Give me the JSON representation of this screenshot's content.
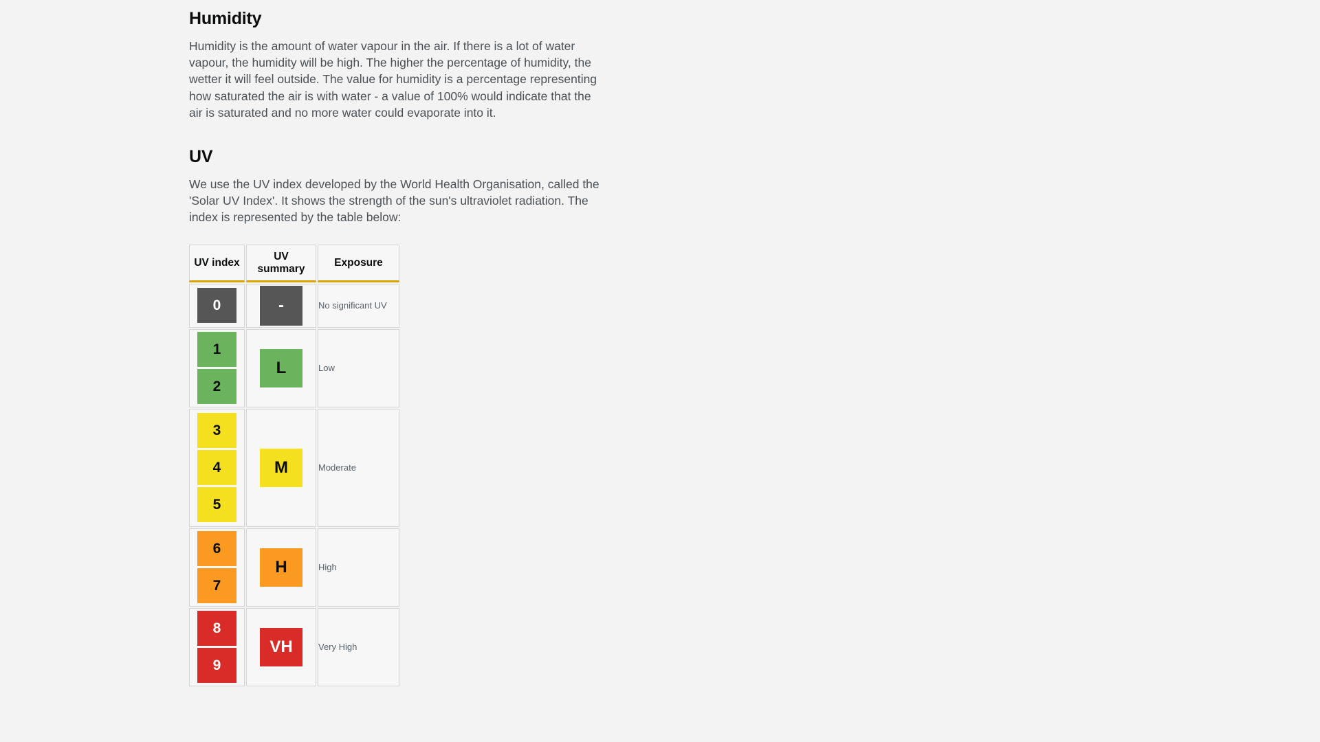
{
  "sections": {
    "humidity": {
      "heading": "Humidity",
      "paragraph": "Humidity is the amount of water vapour in the air. If there is a lot of water vapour, the humidity will be high. The higher the percentage of humidity, the wetter it will feel outside. The value for humidity is a percentage representing how saturated the air is with water - a value of 100% would indicate that the air is saturated and no more water could evaporate into it."
    },
    "uv": {
      "heading": "UV",
      "paragraph": "We use the UV index developed by the World Health Organisation, called the 'Solar UV Index'. It shows the strength of the sun's ultraviolet radiation. The index is represented by the table below:"
    }
  },
  "uv_table": {
    "headers": {
      "index": "UV index",
      "summary": "UV summary",
      "exposure": "Exposure"
    },
    "header_underline_color": "#d9a300",
    "rows": [
      {
        "indices": [
          "0"
        ],
        "summary": "-",
        "exposure": "No significant UV",
        "color": "#565656",
        "text_color": "#ffffff"
      },
      {
        "indices": [
          "1",
          "2"
        ],
        "summary": "L",
        "exposure": "Low",
        "color": "#6cb35e",
        "text_color": "#0b0c0c"
      },
      {
        "indices": [
          "3",
          "4",
          "5"
        ],
        "summary": "M",
        "exposure": "Moderate",
        "color": "#f5e020",
        "text_color": "#0b0c0c"
      },
      {
        "indices": [
          "6",
          "7"
        ],
        "summary": "H",
        "exposure": "High",
        "color": "#fb9a21",
        "text_color": "#0b0c0c"
      },
      {
        "indices": [
          "8",
          "9"
        ],
        "summary": "VH",
        "exposure": "Very High",
        "color": "#d92b27",
        "text_color": "#ffffff"
      }
    ]
  }
}
